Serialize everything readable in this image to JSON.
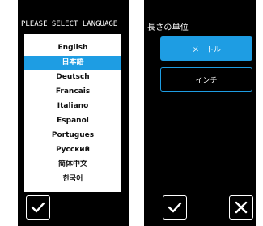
{
  "left_screen": {
    "title": "PLEASE SELECT LANGUAGE",
    "languages": [
      {
        "label": "English",
        "selected": false
      },
      {
        "label": "日本語",
        "selected": true
      },
      {
        "label": "Deutsch",
        "selected": false
      },
      {
        "label": "Francais",
        "selected": false
      },
      {
        "label": "Italiano",
        "selected": false
      },
      {
        "label": "Espanol",
        "selected": false
      },
      {
        "label": "Portugues",
        "selected": false
      },
      {
        "label": "Русский",
        "selected": false
      },
      {
        "label": "简体中文",
        "selected": false
      },
      {
        "label": "한국어",
        "selected": false
      }
    ],
    "confirm_icon": "checkmark-icon"
  },
  "right_screen": {
    "title": "長さの単位",
    "options": [
      {
        "label": "メートル",
        "selected": true
      },
      {
        "label": "インチ",
        "selected": false
      }
    ],
    "confirm_icon": "checkmark-icon",
    "cancel_icon": "close-icon"
  },
  "colors": {
    "screen_background": "#000000",
    "accent": "#1e9de3",
    "text_light": "#ffffff",
    "text_dark": "#111111"
  }
}
